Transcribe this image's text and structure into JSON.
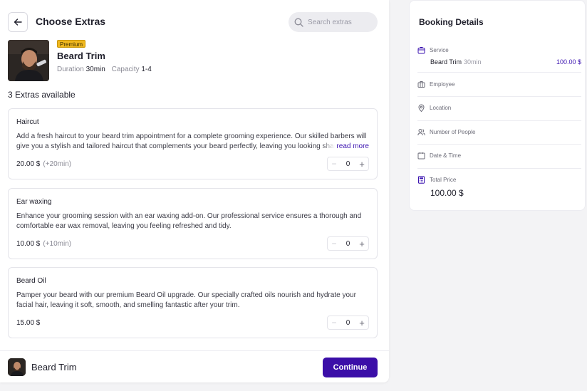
{
  "header": {
    "title": "Choose Extras",
    "search_placeholder": "Search extras"
  },
  "service": {
    "badge": "Premium",
    "name": "Beard Trim",
    "duration_label": "Duration",
    "duration_value": "30min",
    "capacity_label": "Capacity",
    "capacity_value": "1-4"
  },
  "extras_count_label": "3 Extras available",
  "extras": [
    {
      "name": "Haircut",
      "description": "Add a fresh haircut to your beard trim appointment for a complete grooming experience. Our skilled barbers will give you a stylish and tailored haircut that complements your beard perfectly, leaving you looking sharp and confident.",
      "read_more": "read more",
      "price": "20.00 $",
      "duration": "(+20min)",
      "quantity": "0"
    },
    {
      "name": "Ear waxing",
      "description": "Enhance your grooming session with an ear waxing add-on. Our professional service ensures a thorough and comfortable ear wax removal, leaving you feeling refreshed and tidy.",
      "price": "10.00 $",
      "duration": "(+10min)",
      "quantity": "0"
    },
    {
      "name": "Beard Oil",
      "description": "Pamper your beard with our premium Beard Oil upgrade. Our specially crafted oils nourish and hydrate your facial hair, leaving it soft, smooth, and smelling fantastic after your trim.",
      "price": "15.00 $",
      "duration": "",
      "quantity": "0"
    }
  ],
  "footer": {
    "service_name": "Beard Trim",
    "continue_label": "Continue"
  },
  "booking": {
    "title": "Booking Details",
    "service_label": "Service",
    "service_name": "Beard Trim",
    "service_duration": "30min",
    "service_price": "100.00 $",
    "employee_label": "Employee",
    "location_label": "Location",
    "people_label": "Number of People",
    "datetime_label": "Date & Time",
    "total_label": "Total Price",
    "total_value": "100.00 $"
  },
  "colors": {
    "accent": "#3b0ea8",
    "badge": "#f0b81e",
    "background": "#f3f3f5"
  },
  "icons": [
    "arrow-left-icon",
    "search-icon",
    "bag-icon",
    "briefcase-icon",
    "map-pin-icon",
    "users-icon",
    "calendar-icon",
    "calculator-icon",
    "minus-icon",
    "plus-icon"
  ]
}
